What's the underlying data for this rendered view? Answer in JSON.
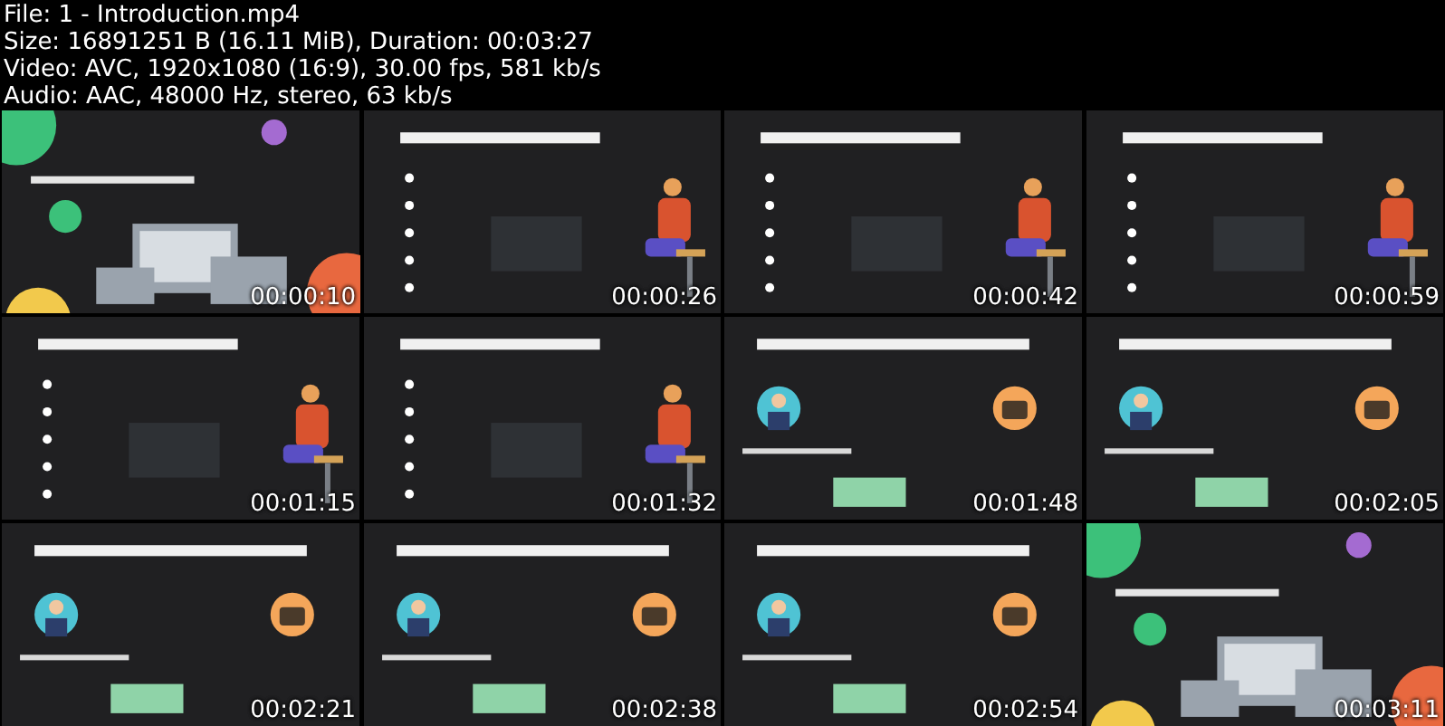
{
  "header": {
    "lines": [
      "File: 1 - Introduction.mp4",
      "Size: 16891251 B (16.11 MiB), Duration: 00:03:27",
      "Video: AVC, 1920x1080 (16:9), 30.00 fps, 581 kb/s",
      "Audio: AAC, 48000 Hz, stereo, 63 kb/s"
    ]
  },
  "thumbnails": [
    {
      "kind": "picture",
      "timestamp": "00:00:10"
    },
    {
      "kind": "picture",
      "timestamp": "00:00:26"
    },
    {
      "kind": "picture",
      "timestamp": "00:00:42"
    },
    {
      "kind": "picture",
      "timestamp": "00:00:59"
    },
    {
      "kind": "picture",
      "timestamp": "00:01:15"
    },
    {
      "kind": "picture",
      "timestamp": "00:01:32"
    },
    {
      "kind": "picture",
      "timestamp": "00:01:48"
    },
    {
      "kind": "picture",
      "timestamp": "00:02:05"
    },
    {
      "kind": "picture",
      "timestamp": "00:02:21"
    },
    {
      "kind": "picture",
      "timestamp": "00:02:38"
    },
    {
      "kind": "picture",
      "timestamp": "00:02:54"
    },
    {
      "kind": "picture",
      "timestamp": "00:03:11"
    }
  ]
}
